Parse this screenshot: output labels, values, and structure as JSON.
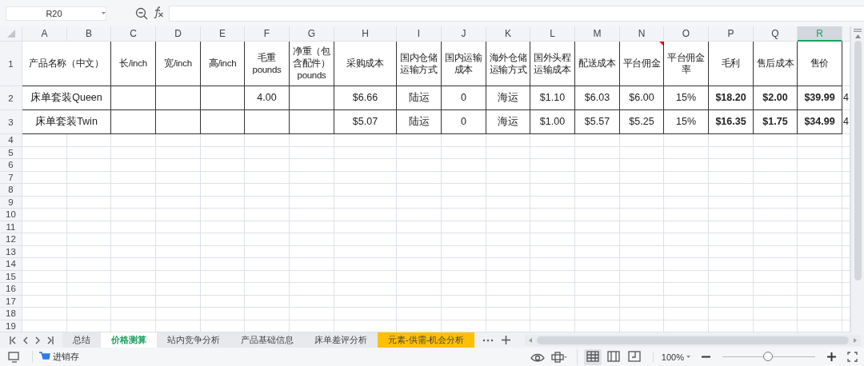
{
  "formula_bar": {
    "name_box": "R20"
  },
  "columns": [
    {
      "letter": "A",
      "selected": false
    },
    {
      "letter": "B",
      "selected": false
    },
    {
      "letter": "C",
      "selected": false
    },
    {
      "letter": "D",
      "selected": false
    },
    {
      "letter": "E",
      "selected": false
    },
    {
      "letter": "F",
      "selected": false
    },
    {
      "letter": "G",
      "selected": false
    },
    {
      "letter": "H",
      "selected": false
    },
    {
      "letter": "I",
      "selected": false
    },
    {
      "letter": "J",
      "selected": false
    },
    {
      "letter": "K",
      "selected": false
    },
    {
      "letter": "L",
      "selected": false
    },
    {
      "letter": "M",
      "selected": false
    },
    {
      "letter": "N",
      "selected": false
    },
    {
      "letter": "O",
      "selected": false
    },
    {
      "letter": "P",
      "selected": false
    },
    {
      "letter": "Q",
      "selected": false
    },
    {
      "letter": "R",
      "selected": true
    }
  ],
  "header_row": {
    "number": "1",
    "cells": {
      "A": {
        "text": "产品名称（中文）",
        "comment": false
      },
      "C": {
        "text": "长/inch",
        "comment": false
      },
      "D": {
        "text": "宽/inch",
        "comment": false
      },
      "E": {
        "text": "高/inch",
        "comment": false
      },
      "F": {
        "text": "毛重 pounds",
        "comment": false
      },
      "G": {
        "text": "净重（包含配件）pounds",
        "comment": false
      },
      "H": {
        "text": "采购成本",
        "comment": false
      },
      "I": {
        "text": "国内仓储运输方式",
        "comment": false
      },
      "J": {
        "text": "国内运输成本",
        "comment": false
      },
      "K": {
        "text": "海外仓储运输方式",
        "comment": false
      },
      "L": {
        "text": "国外头程运输成本",
        "comment": false
      },
      "M": {
        "text": "配送成本",
        "comment": false
      },
      "N": {
        "text": "平台佣金",
        "comment": true
      },
      "O": {
        "text": "平台佣金率",
        "comment": false
      },
      "P": {
        "text": "毛利",
        "comment": false
      },
      "Q": {
        "text": "售后成本",
        "comment": false
      },
      "R": {
        "text": "售价",
        "comment": false
      }
    }
  },
  "rows": [
    {
      "number": "2",
      "cells": {
        "A": {
          "text": "床单套装Queen",
          "bold": false
        },
        "F": {
          "text": "4.00",
          "bold": false
        },
        "H": {
          "text": "$6.66",
          "bold": false
        },
        "I": {
          "text": "陆运",
          "bold": false
        },
        "J": {
          "text": "0",
          "bold": false
        },
        "K": {
          "text": "海运",
          "bold": false
        },
        "L": {
          "text": "$1.10",
          "bold": false
        },
        "M": {
          "text": "$6.03",
          "bold": false
        },
        "N": {
          "text": "$6.00",
          "bold": false
        },
        "O": {
          "text": "15%",
          "bold": false
        },
        "P": {
          "text": "$18.20",
          "bold": true
        },
        "Q": {
          "text": "$2.00",
          "bold": true
        },
        "R": {
          "text": "$39.99",
          "bold": true
        },
        "S": {
          "text": "4",
          "bold": false
        }
      }
    },
    {
      "number": "3",
      "cells": {
        "A": {
          "text": "床单套装Twin",
          "bold": false
        },
        "H": {
          "text": "$5.07",
          "bold": false
        },
        "I": {
          "text": "陆运",
          "bold": false
        },
        "J": {
          "text": "0",
          "bold": false
        },
        "K": {
          "text": "海运",
          "bold": false
        },
        "L": {
          "text": "$1.00",
          "bold": false
        },
        "M": {
          "text": "$5.57",
          "bold": false
        },
        "N": {
          "text": "$5.25",
          "bold": false
        },
        "O": {
          "text": "15%",
          "bold": false
        },
        "P": {
          "text": "$16.35",
          "bold": true
        },
        "Q": {
          "text": "$1.75",
          "bold": true
        },
        "R": {
          "text": "$34.99",
          "bold": true
        },
        "S": {
          "text": "4",
          "bold": false
        }
      }
    }
  ],
  "empty_rows": [
    "4",
    "5",
    "6",
    "7",
    "8",
    "9",
    "10",
    "11",
    "12",
    "13",
    "14",
    "15",
    "16",
    "17",
    "18",
    "19"
  ],
  "sheet_tabs": [
    {
      "label": "总结",
      "selected": false
    },
    {
      "label": "价格测算",
      "selected": true
    },
    {
      "label": "站内竞争分析",
      "selected": false
    },
    {
      "label": "产品基础信息",
      "selected": false
    },
    {
      "label": "床单差评分析",
      "selected": false
    },
    {
      "label": "元素-供需-机会分析",
      "selected": false,
      "color": "#ffc000"
    }
  ],
  "status_bar": {
    "app_label": "进销存",
    "view_modes": [
      {
        "kind": "normal",
        "selected": true
      },
      {
        "kind": "reading",
        "selected": false
      },
      {
        "kind": "page",
        "selected": false
      }
    ],
    "zoom": {
      "reading": "100%",
      "level": 0.49
    }
  }
}
